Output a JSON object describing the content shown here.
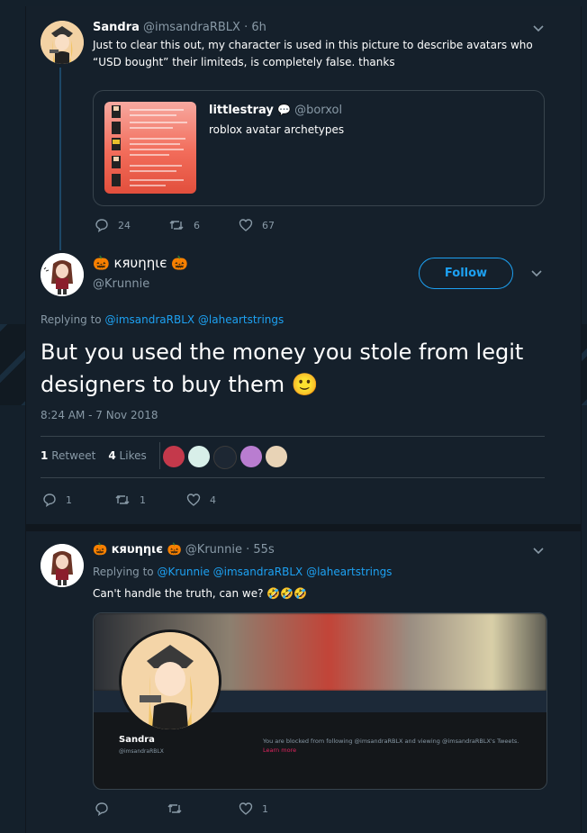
{
  "tweet1": {
    "name": "Sandra",
    "handle": "@imsandraRBLX",
    "time": "· 6h",
    "text": "Just to clear this out, my character is used in this picture to describe avatars who “USD bought” their limiteds, is completely false. thanks",
    "quote": {
      "name": "littlestray",
      "handle": "@borxol",
      "text": "roblox avatar archetypes"
    },
    "replies": "24",
    "retweets": "6",
    "likes": "67"
  },
  "main_tweet": {
    "name": "🎃 кяυηηιє 🎃",
    "handle": "@Krunnie",
    "follow_label": "Follow",
    "replying_prefix": "Replying to",
    "replying_users": "@imsandraRBLX @laheartstrings",
    "text": "But you used the money you stole from legit designers to buy them 🙂",
    "timestamp": "8:24 AM - 7 Nov 2018",
    "retweet_count": "1",
    "retweet_label": "Retweet",
    "like_count": "4",
    "like_label": "Likes",
    "replies": "1",
    "retweets": "1",
    "likes": "4"
  },
  "reply_tweet": {
    "name": "🎃 кяυηηιє 🎃",
    "handle": "@Krunnie",
    "time": "· 55s",
    "replying_prefix": "Replying to",
    "replying_users": "@Krunnie @imsandraRBLX @laheartstrings",
    "text": "Can't handle the truth, can we? 🤣🤣🤣",
    "card": {
      "profile_name": "Sandra",
      "profile_handle": "@imsandraRBLX",
      "blocked_text": "You are blocked from following @imsandraRBLX and viewing @imsandraRBLX's Tweets.",
      "learn_more": "Learn more"
    },
    "replies": "",
    "retweets": "",
    "likes": "1"
  },
  "colors": {
    "accent": "#1da1f2",
    "background": "#15202b",
    "muted": "#8899a6",
    "like_heart": "#e0245e"
  }
}
